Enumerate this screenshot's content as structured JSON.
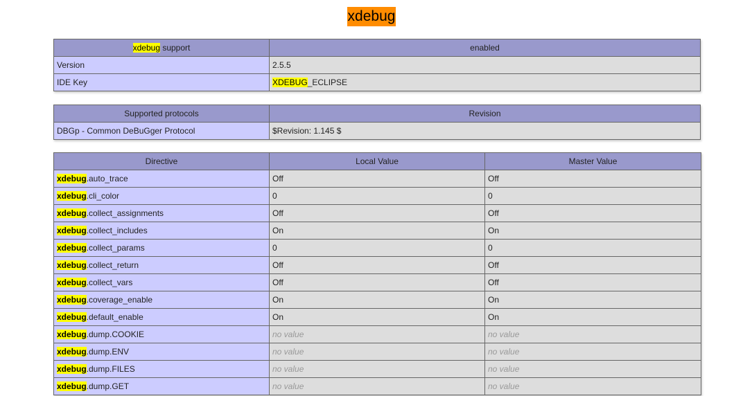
{
  "page": {
    "title": "xdebug"
  },
  "support_table": {
    "header": {
      "highlight": "xdebug",
      "label_rest": " support",
      "value": "enabled"
    },
    "rows": [
      {
        "key": "Version",
        "value": "2.5.5"
      },
      {
        "key": "IDE Key",
        "value_highlight": "XDEBUG",
        "value_rest": "_ECLIPSE"
      }
    ]
  },
  "protocols_table": {
    "headers": [
      "Supported protocols",
      "Revision"
    ],
    "rows": [
      {
        "protocol": "DBGp - Common DeBuGger Protocol",
        "revision": "$Revision: 1.145 $"
      }
    ]
  },
  "directives_table": {
    "headers": [
      "Directive",
      "Local Value",
      "Master Value"
    ],
    "prefix": "xdebug",
    "rows": [
      {
        "name": ".auto_trace",
        "local": "Off",
        "master": "Off"
      },
      {
        "name": ".cli_color",
        "local": "0",
        "master": "0"
      },
      {
        "name": ".collect_assignments",
        "local": "Off",
        "master": "Off"
      },
      {
        "name": ".collect_includes",
        "local": "On",
        "master": "On"
      },
      {
        "name": ".collect_params",
        "local": "0",
        "master": "0"
      },
      {
        "name": ".collect_return",
        "local": "Off",
        "master": "Off"
      },
      {
        "name": ".collect_vars",
        "local": "Off",
        "master": "Off"
      },
      {
        "name": ".coverage_enable",
        "local": "On",
        "master": "On"
      },
      {
        "name": ".default_enable",
        "local": "On",
        "master": "On"
      },
      {
        "name": ".dump.COOKIE",
        "local": "no value",
        "master": "no value"
      },
      {
        "name": ".dump.ENV",
        "local": "no value",
        "master": "no value"
      },
      {
        "name": ".dump.FILES",
        "local": "no value",
        "master": "no value"
      },
      {
        "name": ".dump.GET",
        "local": "no value",
        "master": "no value"
      }
    ]
  },
  "colors": {
    "title_bg": "#ff8c00",
    "header_bg": "#9999cc",
    "key_bg": "#ccccff",
    "value_bg": "#dddddd",
    "highlight": "#ffff00"
  }
}
